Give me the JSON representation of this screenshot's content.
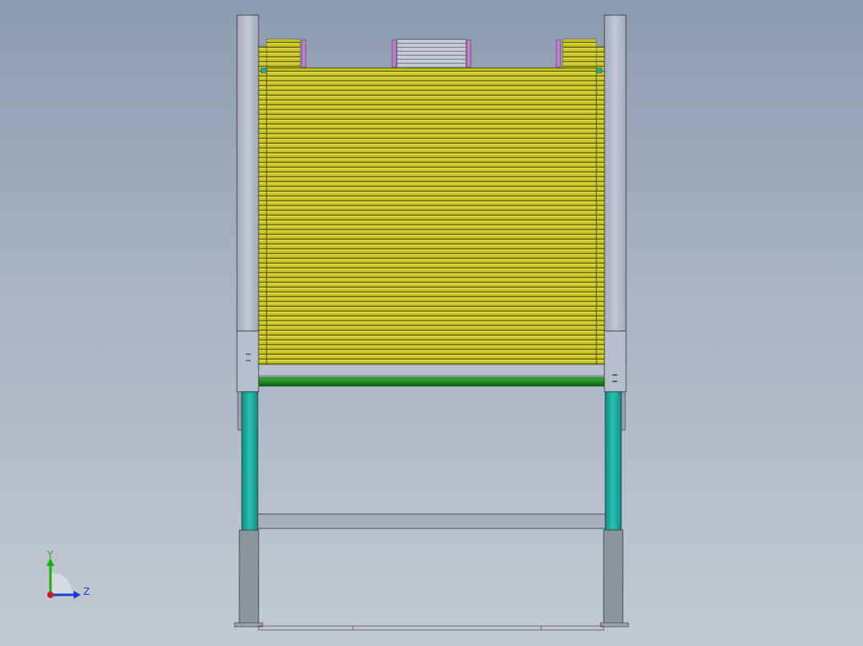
{
  "window": {
    "background_top": "#8d9bb0",
    "background_bottom": "#c3c9d2"
  },
  "model": {
    "roller_color": "#c9c624",
    "roller_dark": "#7c7a14",
    "frame_color": "#b9bfcf",
    "leg_color": "#1faaa0",
    "crossbar_color": "#1f8a1f",
    "flange_color": "#c77ad6",
    "base_color": "#8f959e"
  },
  "triad": {
    "y_label": "Y",
    "z_label": "Z",
    "y_color": "#12b312",
    "z_color": "#1a3ad8",
    "x_color": "#d01a1a"
  }
}
